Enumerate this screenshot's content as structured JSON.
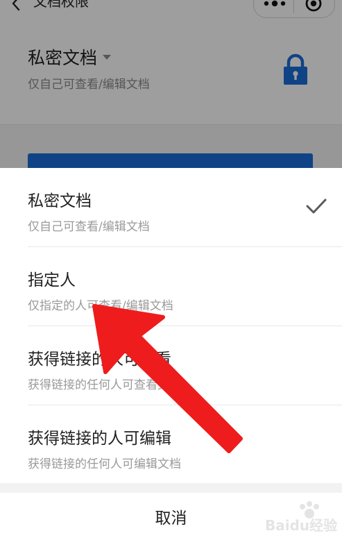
{
  "navbar": {
    "title": "文档权限",
    "icons": {
      "back": "chevron-left-icon",
      "more": "more-dots-icon",
      "close": "target-close-icon"
    }
  },
  "current_permission": {
    "title": "私密文档",
    "description": "仅自己可查看/编辑文档",
    "icon": "lock-icon"
  },
  "sheet": {
    "options": [
      {
        "title": "私密文档",
        "description": "仅自己可查看/编辑文档",
        "selected": true
      },
      {
        "title": "指定人",
        "description": "仅指定的人可查看/编辑文档",
        "selected": false
      },
      {
        "title": "获得链接的人可查看",
        "description": "获得链接的任何人可查看文档",
        "selected": false
      },
      {
        "title": "获得链接的人可编辑",
        "description": "获得链接的任何人可编辑文档",
        "selected": false
      }
    ],
    "cancel_label": "取消"
  },
  "colors": {
    "accent_blue": "#1a6cd9",
    "annotation_red": "#ee1c1c",
    "overlay": "rgba(0,0,0,0.38)"
  },
  "watermark": {
    "text": "Baidu经验"
  }
}
